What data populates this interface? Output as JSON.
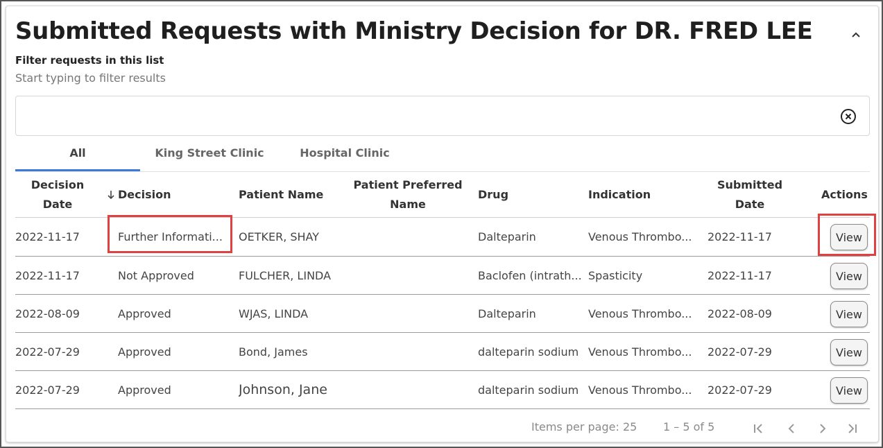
{
  "header": {
    "title": "Submitted Requests with Ministry Decision for DR. FRED LEE",
    "collapse_icon": "chevron-up-icon"
  },
  "filter": {
    "label": "Filter requests in this list",
    "hint": "Start typing to filter results",
    "value": "",
    "clear_icon": "clear-circle-icon"
  },
  "tabs": [
    {
      "label": "All",
      "active": true
    },
    {
      "label": "King Street Clinic",
      "active": false
    },
    {
      "label": "Hospital Clinic",
      "active": false
    }
  ],
  "table": {
    "columns": {
      "decision_date": "Decision Date",
      "decision": "Decision",
      "patient_name": "Patient Name",
      "preferred_name": "Patient Preferred Name",
      "drug": "Drug",
      "indication": "Indication",
      "submitted_date": "Submitted Date",
      "actions": "Actions"
    },
    "sort_icon": "arrow-down-icon",
    "rows": [
      {
        "decision_date": "2022-11-17",
        "decision": "Further Informati...",
        "patient_name": "OETKER, SHAY",
        "preferred_name": "",
        "drug": "Dalteparin",
        "indication": "Venous Thrombo...",
        "submitted_date": "2022-11-17",
        "action": "View"
      },
      {
        "decision_date": "2022-11-17",
        "decision": "Not Approved",
        "patient_name": "FULCHER, LINDA",
        "preferred_name": "",
        "drug": "Baclofen (intrath...",
        "indication": "Spasticity",
        "submitted_date": "2022-11-17",
        "action": "View"
      },
      {
        "decision_date": "2022-08-09",
        "decision": "Approved",
        "patient_name": "WJAS, LINDA",
        "preferred_name": "",
        "drug": "Dalteparin",
        "indication": "Venous Thrombo...",
        "submitted_date": "2022-08-09",
        "action": "View"
      },
      {
        "decision_date": "2022-07-29",
        "decision": "Approved",
        "patient_name": "Bond, James",
        "preferred_name": "",
        "drug": "dalteparin sodium",
        "indication": "Venous Thrombo...",
        "submitted_date": "2022-07-29",
        "action": "View"
      },
      {
        "decision_date": "2022-07-29",
        "decision": "Approved",
        "patient_name": "Johnson, Jane",
        "preferred_name": "",
        "drug": "dalteparin sodium",
        "indication": "Venous Thrombo...",
        "submitted_date": "2022-07-29",
        "action": "View"
      }
    ]
  },
  "paginator": {
    "items_per_page": "Items per page: 25",
    "range": "1 – 5 of 5",
    "first_icon": "first-page-icon",
    "prev_icon": "chevron-left-icon",
    "next_icon": "chevron-right-icon",
    "last_icon": "last-page-icon"
  },
  "colors": {
    "highlight": "#e04040",
    "tab_indicator": "#3a7bd5"
  }
}
